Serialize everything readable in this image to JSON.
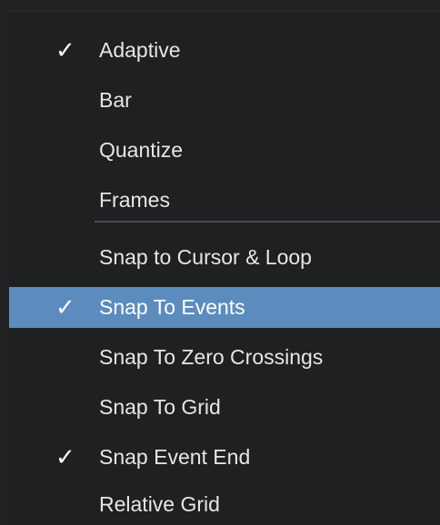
{
  "menu": {
    "check_glyph": "✓",
    "items": [
      {
        "label": "Adaptive",
        "checked": true,
        "selected": false
      },
      {
        "label": "Bar",
        "checked": false,
        "selected": false
      },
      {
        "label": "Quantize",
        "checked": false,
        "selected": false
      },
      {
        "label": "Frames",
        "checked": false,
        "selected": false
      },
      {
        "label": "Snap to Cursor & Loop",
        "checked": false,
        "selected": false
      },
      {
        "label": "Snap To Events",
        "checked": true,
        "selected": true
      },
      {
        "label": "Snap To Zero Crossings",
        "checked": false,
        "selected": false
      },
      {
        "label": "Snap To Grid",
        "checked": false,
        "selected": false
      },
      {
        "label": "Snap Event End",
        "checked": true,
        "selected": false
      },
      {
        "label": "Relative Grid",
        "checked": false,
        "selected": false
      }
    ],
    "colors": {
      "background": "#1f2022",
      "highlight": "#5b8cbd",
      "text": "#e6e6e6",
      "separator": "#4a4b4f"
    }
  }
}
